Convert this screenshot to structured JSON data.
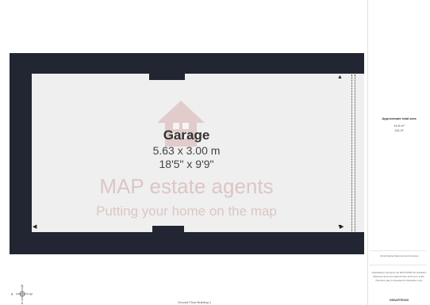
{
  "room": {
    "name": "Garage",
    "metric": "5.63 x 3.00 m",
    "imperial": "18'5\" x 9'9\""
  },
  "watermark": {
    "title": "MAP estate agents",
    "tagline": "Putting your home on the map"
  },
  "panel": {
    "area_title": "Approximate total area",
    "area_m2": "16.8 m²",
    "area_ft2": "181 ft²",
    "note_excluding": "(1) Excluding balconies and terraces",
    "calc_note": "Calculations reference the RICS IPMS 3C standard. Measurements are approximate and not to scale. This floor plan is intended for illustration only.",
    "brand": "GIRAFFE360"
  },
  "floor_label": "Ground Floor   Building 1",
  "compass": {
    "n": "N",
    "s": "S",
    "e": "E",
    "w": "W"
  },
  "colors": {
    "wall": "#222633",
    "floor": "#efefef",
    "watermark": "#be7878"
  }
}
